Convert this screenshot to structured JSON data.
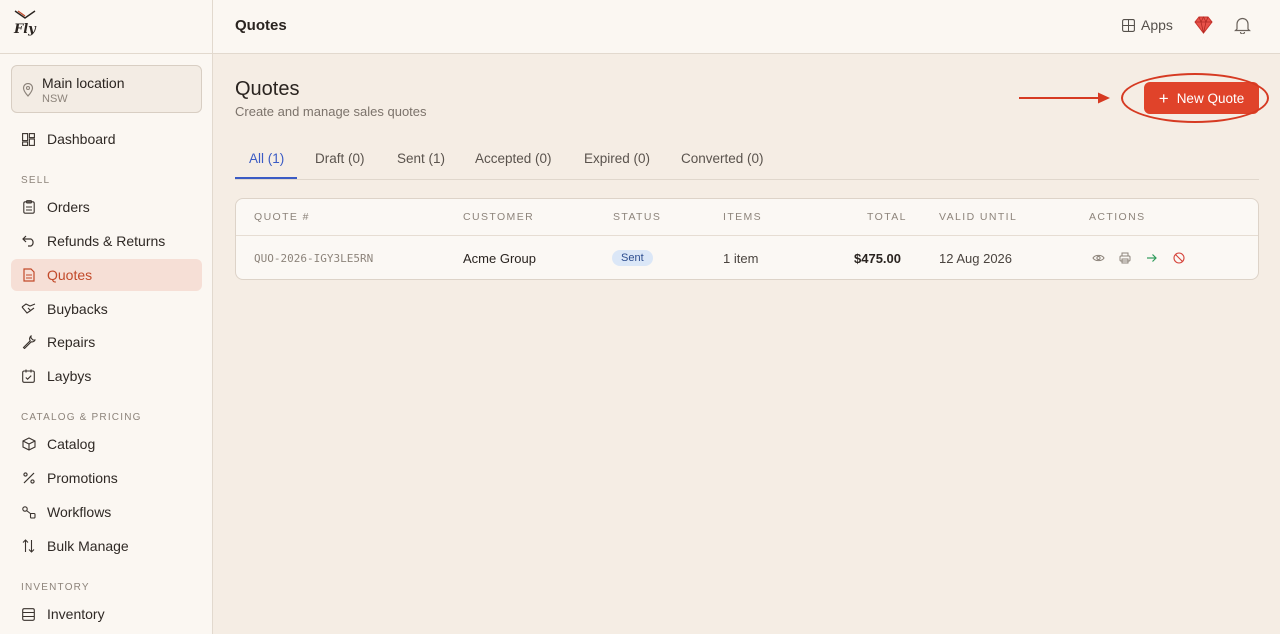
{
  "brand": {
    "name": "Fly"
  },
  "sidebar": {
    "location": {
      "name": "Main location",
      "sub": "NSW"
    },
    "dashboard": "Dashboard",
    "sections": {
      "sell": "SELL",
      "catalog": "CATALOG & PRICING",
      "inventory": "INVENTORY"
    },
    "sell_items": [
      {
        "label": "Orders",
        "icon": "clipboard-icon"
      },
      {
        "label": "Refunds & Returns",
        "icon": "undo-icon"
      },
      {
        "label": "Quotes",
        "icon": "document-icon"
      },
      {
        "label": "Buybacks",
        "icon": "handshake-icon"
      },
      {
        "label": "Repairs",
        "icon": "wrench-icon"
      },
      {
        "label": "Laybys",
        "icon": "calendar-check-icon"
      }
    ],
    "catalog_items": [
      {
        "label": "Catalog",
        "icon": "box-icon"
      },
      {
        "label": "Promotions",
        "icon": "percent-icon"
      },
      {
        "label": "Workflows",
        "icon": "workflow-icon"
      },
      {
        "label": "Bulk Manage",
        "icon": "arrows-updown-icon"
      }
    ],
    "inventory_items": [
      {
        "label": "Inventory",
        "icon": "stack-icon"
      }
    ]
  },
  "header": {
    "title": "Quotes",
    "apps_label": "Apps"
  },
  "main": {
    "title": "Quotes",
    "subtitle": "Create and manage sales quotes",
    "new_quote_label": "New Quote",
    "tabs": [
      "All (1)",
      "Draft (0)",
      "Sent (1)",
      "Accepted (0)",
      "Expired (0)",
      "Converted (0)"
    ],
    "table": {
      "headers": [
        "QUOTE #",
        "CUSTOMER",
        "STATUS",
        "ITEMS",
        "TOTAL",
        "VALID UNTIL",
        "ACTIONS"
      ],
      "rows": [
        {
          "quote_no": "QUO-2026-IGY3LE5RN",
          "customer": "Acme Group",
          "status": "Sent",
          "items": "1 item",
          "total": "$475.00",
          "valid_until": "12 Aug 2026"
        }
      ]
    }
  },
  "colors": {
    "accent": "#e0432a",
    "tab_active": "#3b5bc4",
    "annotation": "#d63a22"
  }
}
